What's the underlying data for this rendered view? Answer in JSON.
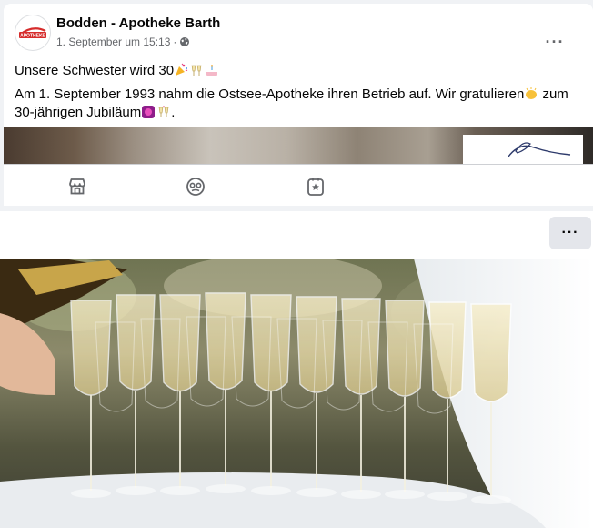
{
  "post": {
    "author": "Bodden - Apotheke Barth",
    "avatar_text": "APOTHEKE",
    "date": "1. September um 15:13",
    "visibility_separator": "·",
    "visibility_icon": "globe-icon",
    "more_label": "···",
    "text_line1": "Unsere Schwester wird 30",
    "text_line1_emojis": [
      "party-popper",
      "clinking-glasses",
      "birthday-cake"
    ],
    "text_line2": "Am 1. September 1993 nahm die Ostsee-Apotheke ihren Betrieb auf. Wir gratulieren",
    "text_line2_emoji": "clapping-hands",
    "text_line2_cont": " zum 30-jährigen Jubiläum",
    "text_line2_emojis": [
      "party-ball",
      "clinking-glasses"
    ],
    "text_line2_end": "."
  },
  "actions": [
    {
      "name": "shop-icon"
    },
    {
      "name": "face-icon"
    },
    {
      "name": "star-page-icon"
    }
  ],
  "second_post": {
    "more_label": "···"
  },
  "colors": {
    "background": "#f0f2f5",
    "text_primary": "#050505",
    "text_secondary": "#65676b",
    "button_gray": "#e4e6eb",
    "avatar_red": "#d62c2c"
  }
}
